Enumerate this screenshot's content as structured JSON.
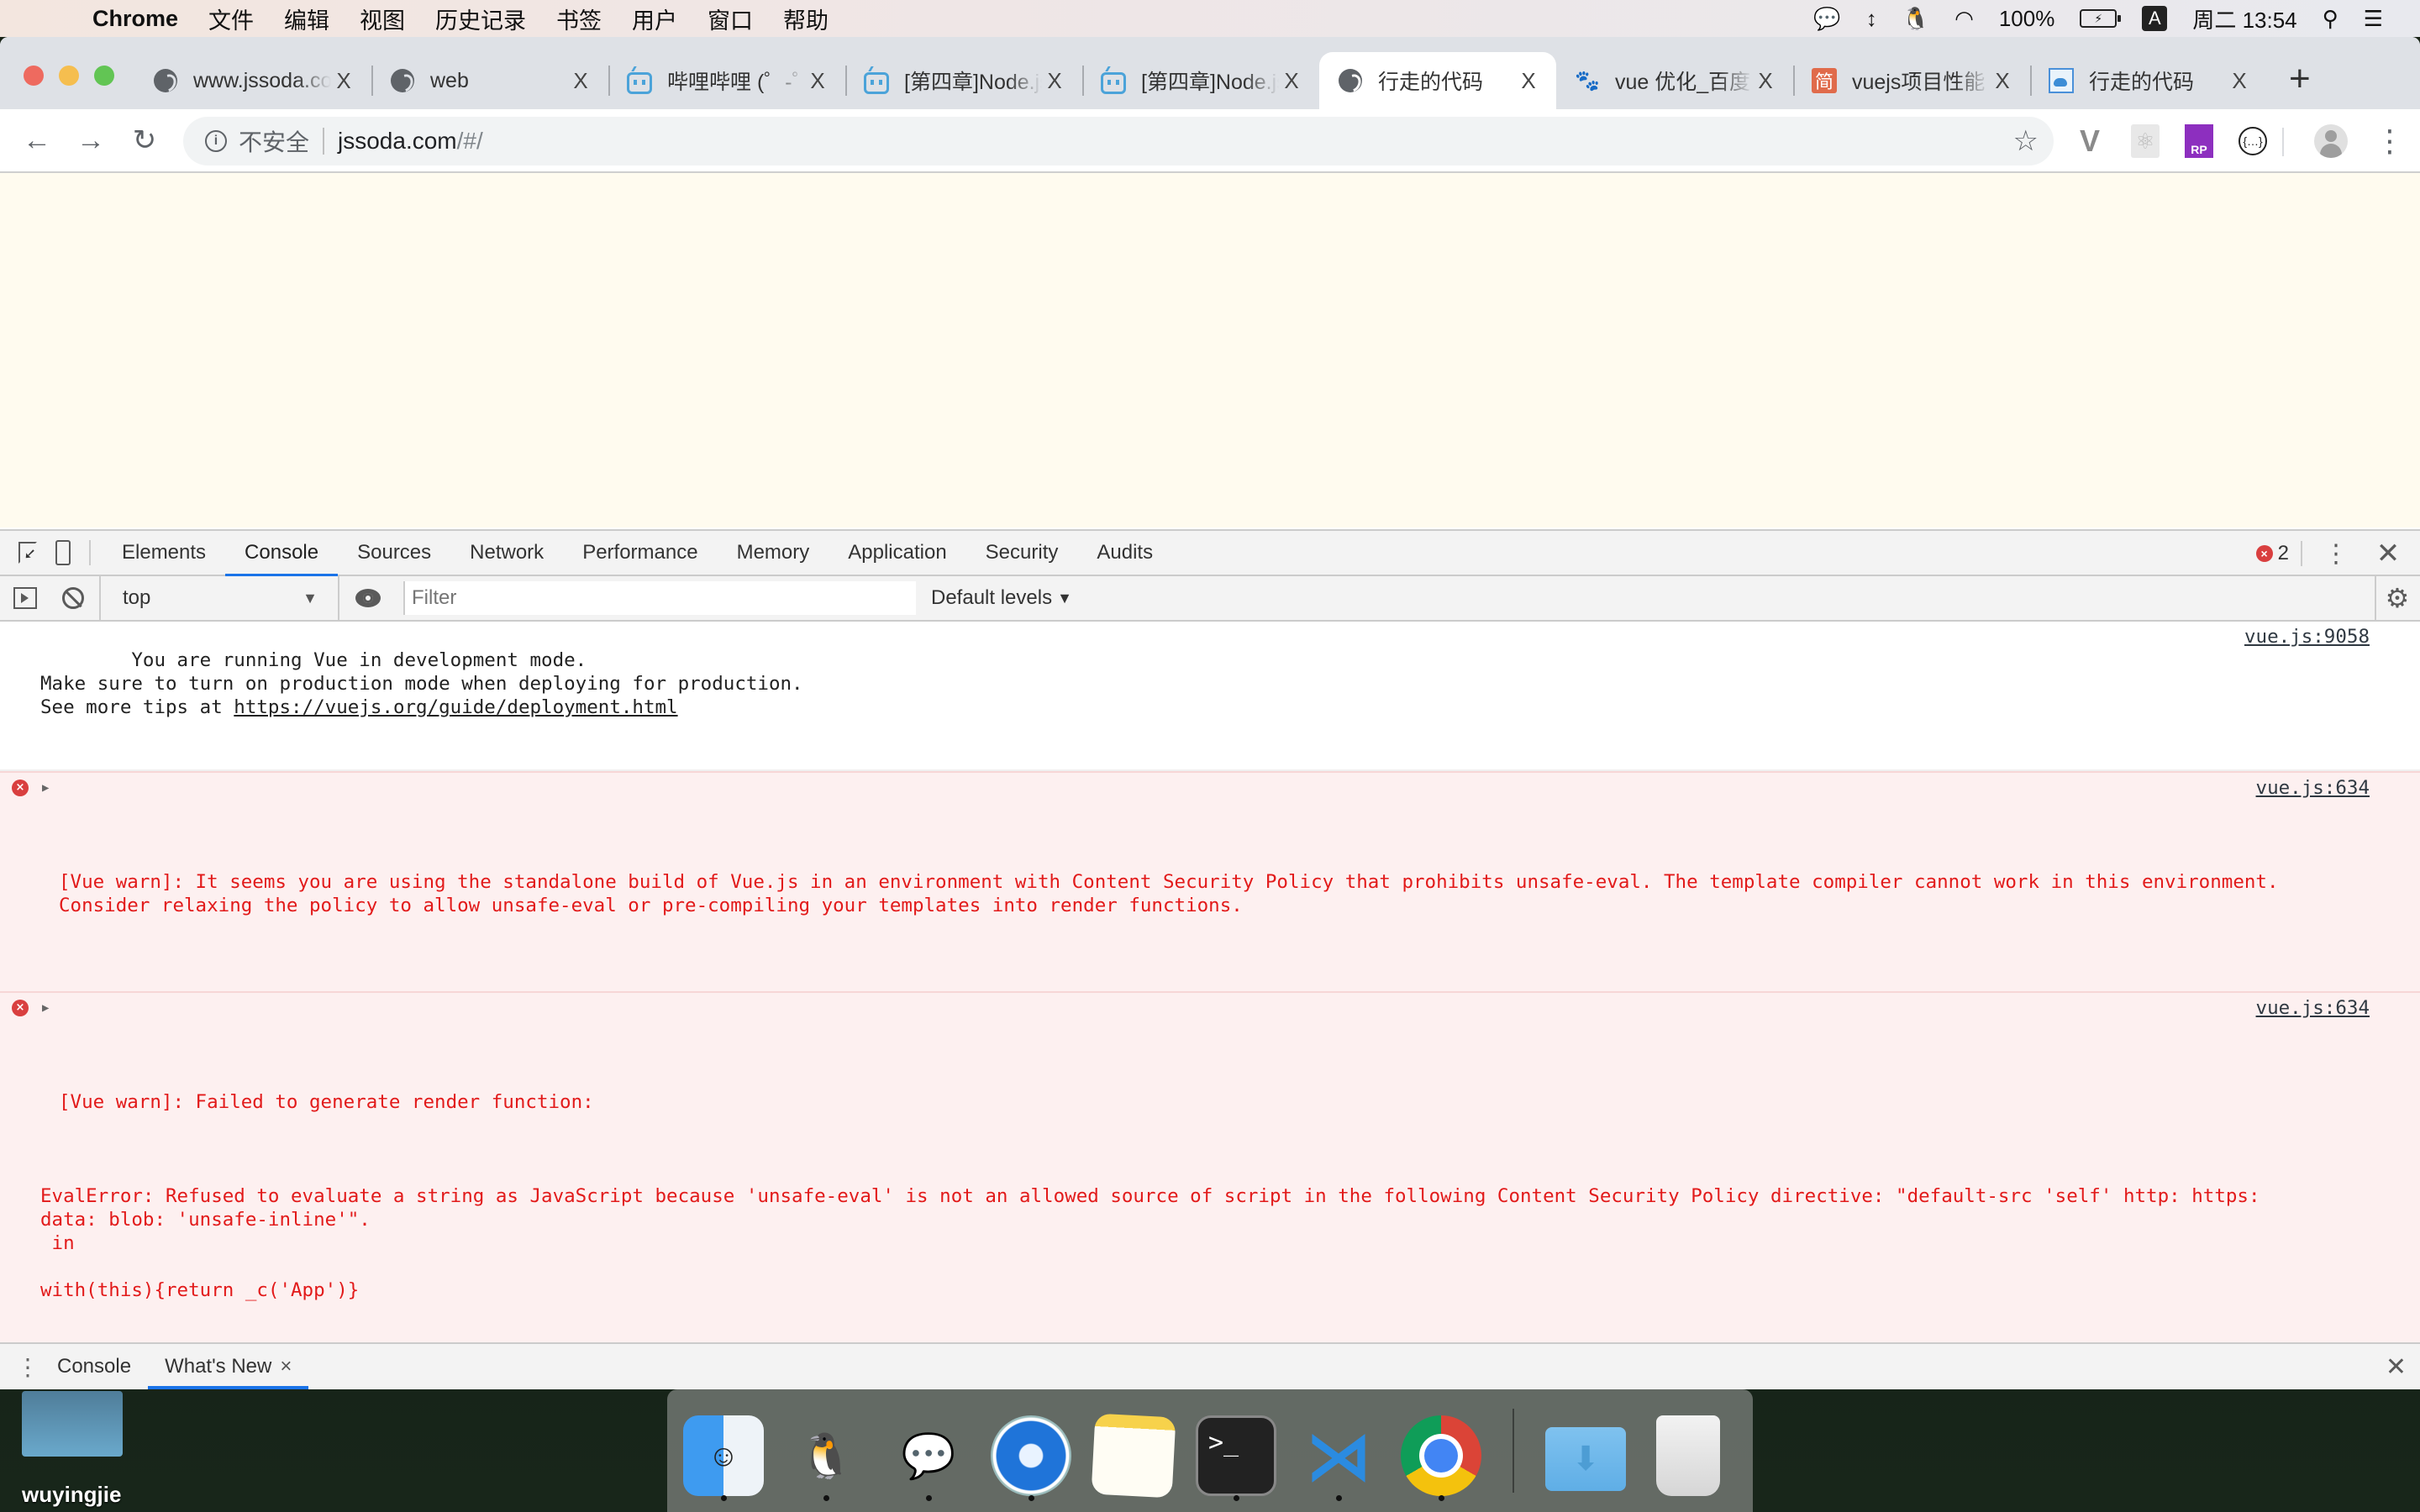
{
  "menubar": {
    "app_name": "Chrome",
    "items": [
      "文件",
      "编辑",
      "视图",
      "历史记录",
      "书签",
      "用户",
      "窗口",
      "帮助"
    ],
    "status": {
      "battery": "100%",
      "input_method": "A",
      "clock": "周二 13:54"
    }
  },
  "browser": {
    "tabs": [
      {
        "title": "www.jssoda.com",
        "favicon": "globe-icon",
        "active": false
      },
      {
        "title": "web",
        "favicon": "globe-icon",
        "active": false
      },
      {
        "title": "哔哩哔哩 (゜-゜)つロ",
        "favicon": "bilibili-icon",
        "active": false
      },
      {
        "title": "[第四章]Node.js",
        "favicon": "bilibili-icon",
        "active": false
      },
      {
        "title": "[第四章]Node.js",
        "favicon": "bilibili-icon",
        "active": false
      },
      {
        "title": "行走的代码",
        "favicon": "globe-icon",
        "active": true
      },
      {
        "title": "vue 优化_百度",
        "favicon": "baidu-icon",
        "active": false
      },
      {
        "title": "vuejs项目性能",
        "favicon": "jianshu-icon",
        "active": false
      },
      {
        "title": "行走的代码",
        "favicon": "whale-icon",
        "active": false
      }
    ],
    "close_glyph": "X",
    "new_tab_glyph": "+",
    "omnibox": {
      "security_label": "不安全",
      "host": "jssoda.com",
      "path": "/#/"
    },
    "extensions": [
      "vue-devtools",
      "react-devtools",
      "axure-rp",
      "json-viewer"
    ]
  },
  "devtools": {
    "tabs": [
      "Elements",
      "Console",
      "Sources",
      "Network",
      "Performance",
      "Memory",
      "Application",
      "Security",
      "Audits"
    ],
    "active_tab": "Console",
    "error_count": "2",
    "console_toolbar": {
      "context": "top",
      "filter_placeholder": "Filter",
      "levels": "Default levels"
    },
    "messages": [
      {
        "type": "info",
        "lines": [
          "You are running Vue in development mode.",
          "Make sure to turn on production mode when deploying for production.",
          "See more tips at "
        ],
        "link": "https://vuejs.org/guide/deployment.html",
        "source": "vue.js:9058"
      },
      {
        "type": "error",
        "text": "[Vue warn]: It seems you are using the standalone build of Vue.js in an environment with Content Security Policy that prohibits unsafe-eval. The template compiler cannot work in this environment. Consider relaxing the policy to allow unsafe-eval or pre-compiling your templates into render functions.",
        "source": "vue.js:634"
      },
      {
        "type": "error",
        "text": "[Vue warn]: Failed to generate render function:",
        "body": "\nEvalError: Refused to evaluate a string as JavaScript because 'unsafe-eval' is not an allowed source of script in the following Content Security Policy directive: \"default-src 'self' http: https: data: blob: 'unsafe-inline'\".\n in\n\nwith(this){return _c('App')}\n\n\n(found in <Root>)",
        "source": "vue.js:634"
      }
    ],
    "prompt_glyph": "›",
    "drawer": {
      "tabs": [
        "Console",
        "What's New"
      ],
      "active_tab": "What's New"
    }
  },
  "desktop": {
    "icon_label": "wuyingjie"
  },
  "dock": {
    "apps": [
      {
        "name": "Finder",
        "running": true
      },
      {
        "name": "QQ",
        "running": true
      },
      {
        "name": "WeChat",
        "running": true
      },
      {
        "name": "Safari",
        "running": true
      },
      {
        "name": "Notes",
        "running": false
      },
      {
        "name": "Terminal",
        "running": true
      },
      {
        "name": "Visual Studio Code",
        "running": true
      },
      {
        "name": "Google Chrome",
        "running": true
      },
      {
        "name": "Downloads",
        "running": false
      },
      {
        "name": "Trash",
        "running": false
      }
    ]
  },
  "colors": {
    "accent": "#1a73e8",
    "error_text": "#e21a1a",
    "error_bg": "#fdf0f0",
    "page_bg": "#fffbef"
  }
}
